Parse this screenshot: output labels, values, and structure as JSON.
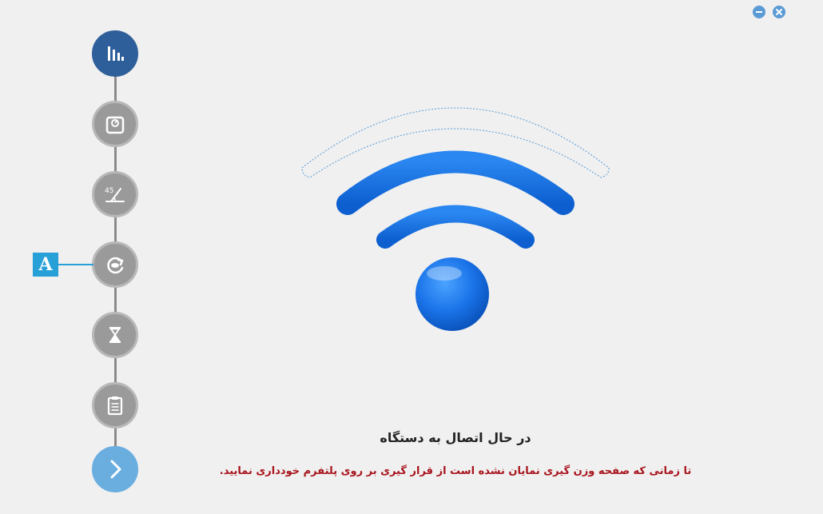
{
  "window": {
    "minimize_icon": "minus-icon",
    "close_icon": "close-icon",
    "accent": "#5b9bd5"
  },
  "steps": [
    {
      "icon": "bar-chart-icon",
      "state": "active"
    },
    {
      "icon": "weighing-scale-icon",
      "state": "inactive"
    },
    {
      "icon": "angle-45-icon",
      "state": "inactive"
    },
    {
      "icon": "rotation-icon",
      "state": "inactive"
    },
    {
      "icon": "hourglass-icon",
      "state": "inactive"
    },
    {
      "icon": "clipboard-icon",
      "state": "inactive"
    },
    {
      "icon": "chevron-right-icon",
      "state": "next"
    }
  ],
  "step_labels": {
    "angle": "45"
  },
  "marker": {
    "label": "A",
    "color": "#27a0d8"
  },
  "wifi": {
    "icon": "wifi-icon",
    "color": "#1a73e8"
  },
  "status": {
    "title": "در حال اتصال به دستگاه",
    "warning": "تا زمانی که صفحه وزن گیری نمایان نشده است از قرار گیری بر روی پلتفرم خودداری نمایید.",
    "warning_color": "#a8141c"
  }
}
